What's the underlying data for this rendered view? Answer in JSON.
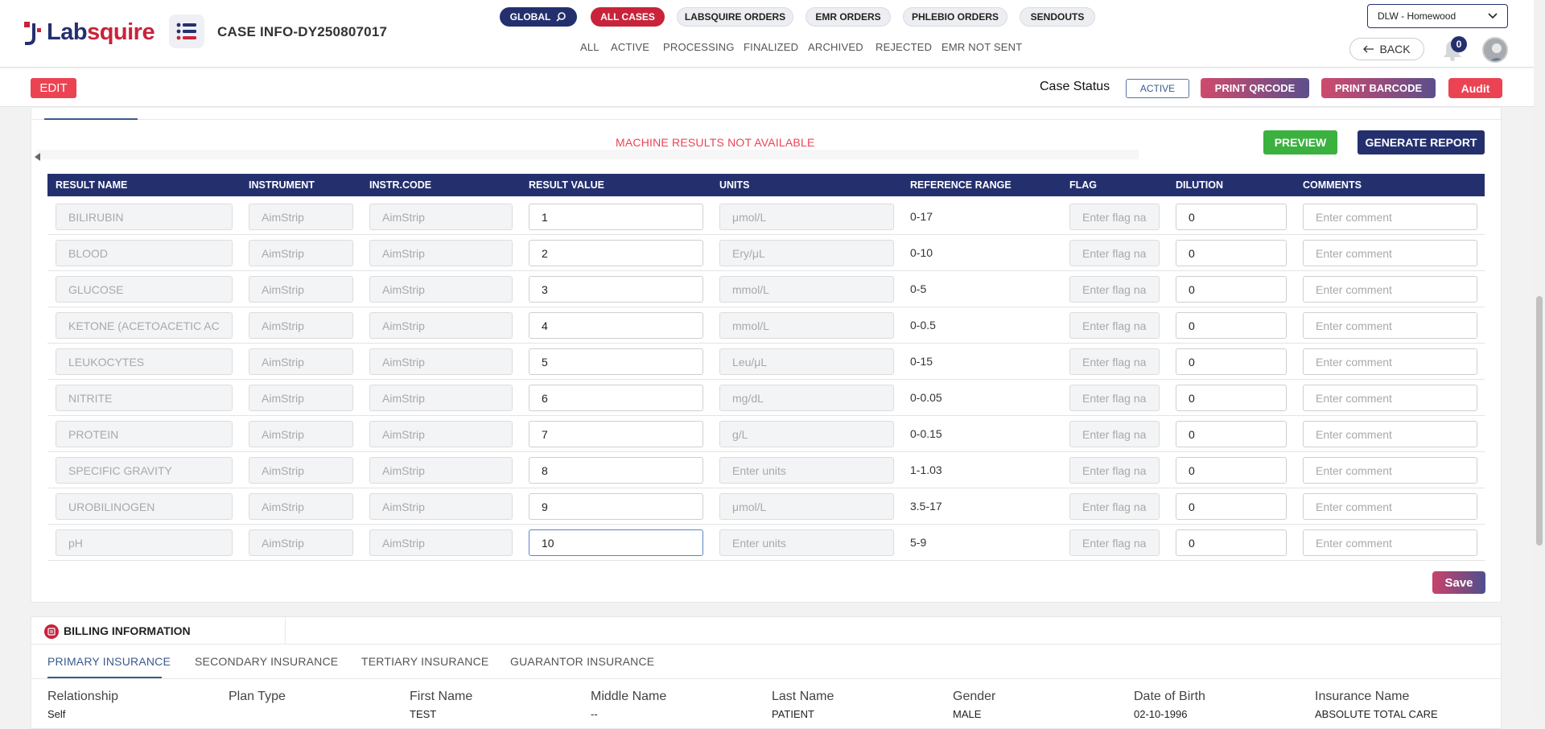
{
  "header": {
    "logo": {
      "prefix": "Lab",
      "suffix": "squire"
    },
    "case_title": "CASE INFO-DY250807017",
    "top_pills": [
      "GLOBAL",
      "ALL CASES",
      "LABSQUIRE ORDERS",
      "EMR ORDERS",
      "PHLEBIO ORDERS",
      "SENDOUTS"
    ],
    "subnav": [
      "ALL",
      "ACTIVE",
      "PROCESSING",
      "FINALIZED",
      "ARCHIVED",
      "REJECTED",
      "EMR NOT SENT"
    ],
    "location": "DLW - Homewood",
    "back_label": "BACK",
    "notifications_count": "0"
  },
  "actionbar": {
    "edit_label": "EDIT",
    "case_status_label": "Case Status",
    "case_status_value": "ACTIVE",
    "print_qrcode_label": "PRINT QRCODE",
    "print_barcode_label": "PRINT BARCODE",
    "audit_label": "Audit"
  },
  "results": {
    "machine_message": "MACHINE RESULTS NOT AVAILABLE",
    "preview_label": "PREVIEW",
    "generate_label": "GENERATE REPORT",
    "columns": [
      "RESULT NAME",
      "INSTRUMENT",
      "INSTR.CODE",
      "RESULT VALUE",
      "UNITS",
      "REFERENCE RANGE",
      "FLAG",
      "DILUTION",
      "COMMENTS"
    ],
    "flag_placeholder": "Enter flag na",
    "comment_placeholder": "Enter comment",
    "units_placeholder": "Enter units",
    "rows": [
      {
        "name": "BILIRUBIN",
        "instrument": "AimStrip",
        "code": "AimStrip",
        "value": "1",
        "units": "μmol/L",
        "ref": "0-17",
        "dilution": "0"
      },
      {
        "name": "BLOOD",
        "instrument": "AimStrip",
        "code": "AimStrip",
        "value": "2",
        "units": "Ery/μL",
        "ref": "0-10",
        "dilution": "0"
      },
      {
        "name": "GLUCOSE",
        "instrument": "AimStrip",
        "code": "AimStrip",
        "value": "3",
        "units": "mmol/L",
        "ref": "0-5",
        "dilution": "0"
      },
      {
        "name": "KETONE (ACETOACETIC AC",
        "instrument": "AimStrip",
        "code": "AimStrip",
        "value": "4",
        "units": "mmol/L",
        "ref": "0-0.5",
        "dilution": "0"
      },
      {
        "name": "LEUKOCYTES",
        "instrument": "AimStrip",
        "code": "AimStrip",
        "value": "5",
        "units": "Leu/μL",
        "ref": "0-15",
        "dilution": "0"
      },
      {
        "name": "NITRITE",
        "instrument": "AimStrip",
        "code": "AimStrip",
        "value": "6",
        "units": "mg/dL",
        "ref": "0-0.05",
        "dilution": "0"
      },
      {
        "name": "PROTEIN",
        "instrument": "AimStrip",
        "code": "AimStrip",
        "value": "7",
        "units": "g/L",
        "ref": "0-0.15",
        "dilution": "0"
      },
      {
        "name": "SPECIFIC GRAVITY",
        "instrument": "AimStrip",
        "code": "AimStrip",
        "value": "8",
        "units": "",
        "ref": "1-1.03",
        "dilution": "0"
      },
      {
        "name": "UROBILINOGEN",
        "instrument": "AimStrip",
        "code": "AimStrip",
        "value": "9",
        "units": "μmol/L",
        "ref": "3.5-17",
        "dilution": "0"
      },
      {
        "name": "pH",
        "instrument": "AimStrip",
        "code": "AimStrip",
        "value": "10",
        "units": "",
        "ref": "5-9",
        "dilution": "0"
      }
    ],
    "save_label": "Save"
  },
  "billing": {
    "title": "BILLING INFORMATION",
    "tabs": [
      "PRIMARY INSURANCE",
      "SECONDARY INSURANCE",
      "TERTIARY INSURANCE",
      "GUARANTOR INSURANCE"
    ],
    "fields": [
      {
        "label": "Relationship",
        "value": "Self"
      },
      {
        "label": "Plan Type",
        "value": ""
      },
      {
        "label": "First Name",
        "value": "TEST"
      },
      {
        "label": "Middle Name",
        "value": "--"
      },
      {
        "label": "Last Name",
        "value": "PATIENT"
      },
      {
        "label": "Gender",
        "value": "MALE"
      },
      {
        "label": "Date of Birth",
        "value": "02-10-1996"
      },
      {
        "label": "Insurance Name",
        "value": "ABSOLUTE TOTAL CARE"
      }
    ]
  },
  "colors": {
    "navy": "#24306e",
    "red": "#c8233a",
    "green": "#3bb13f",
    "alert": "#ec4353"
  }
}
